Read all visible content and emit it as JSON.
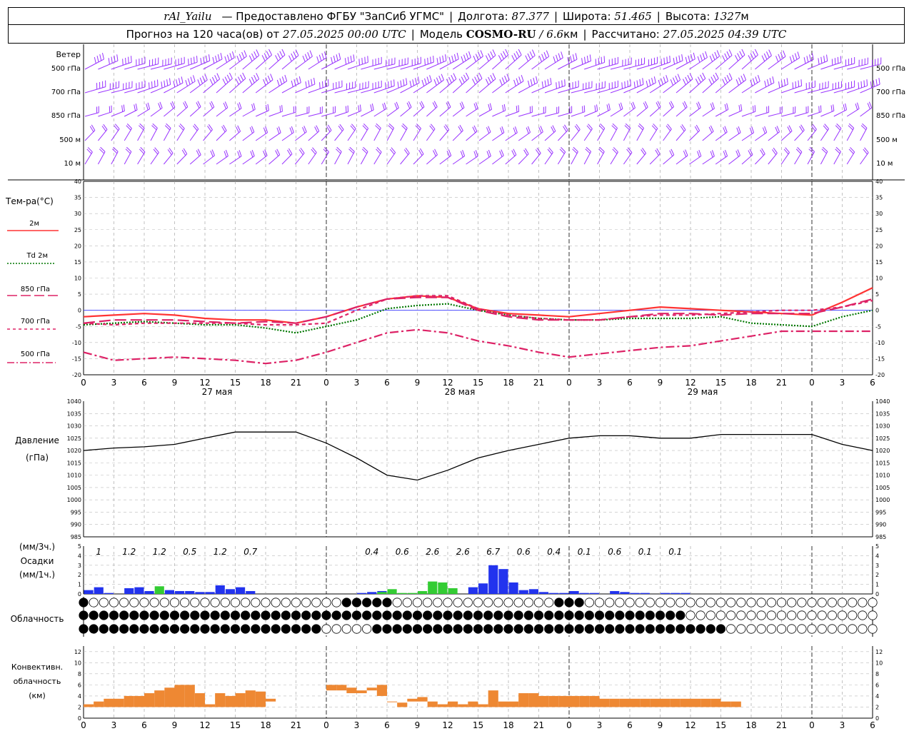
{
  "header": {
    "station": "rAl_Yailu",
    "provider": "— Предоставлено ФГБУ \"ЗапСиб УГМС\"",
    "lon_label": "Долгота:",
    "lon_value": "87.377",
    "lat_label": "Широта:",
    "lat_value": "51.465",
    "alt_label": "Высота:",
    "alt_value": "1327",
    "alt_unit": "м",
    "forecast_label": "Прогноз на 120 часа(ов) от",
    "forecast_start": "27.05.2025 00:00 UTC",
    "model_label": "Модель",
    "model_name": "COSMO-RU",
    "model_res": "/ 6.6",
    "model_res_unit": "км",
    "calc_label": "Рассчитано:",
    "calc_time": "27.05.2025 04:39 UTC"
  },
  "wind": {
    "title": "Ветер",
    "levels": [
      "500 гПа",
      "700 гПа",
      "850 гПа",
      "500 м",
      "10  м"
    ],
    "barb_color": "#9933ff"
  },
  "temperature": {
    "title": "Тем-ра(°C)",
    "legend": [
      {
        "label": "2м",
        "color": "#ff3333"
      },
      {
        "label": "Td  2м",
        "color": "#007700"
      },
      {
        "label": "850 гПа",
        "color": "#dd2266"
      },
      {
        "label": "700 гПа",
        "color": "#dd2266"
      },
      {
        "label": "500 гПа",
        "color": "#dd2266"
      }
    ],
    "y_ticks": [
      40,
      35,
      30,
      25,
      20,
      15,
      10,
      5,
      0,
      -5,
      -10,
      -15,
      -20
    ]
  },
  "time_axis": {
    "hour_labels": [
      "0",
      "3",
      "6",
      "9",
      "12",
      "15",
      "18",
      "21",
      "0",
      "3",
      "6",
      "9",
      "12",
      "15",
      "18",
      "21",
      "0",
      "3",
      "6",
      "9",
      "12",
      "15",
      "18",
      "21",
      "0",
      "3",
      "6"
    ],
    "day_labels": [
      "27 мая",
      "28 мая",
      "29 мая"
    ]
  },
  "pressure": {
    "title": "Давление",
    "unit": "(гПа)",
    "y_ticks": [
      1040,
      1035,
      1030,
      1025,
      1020,
      1015,
      1010,
      1005,
      1000,
      995,
      990,
      985
    ]
  },
  "precip": {
    "title_3h": "(мм/3ч.)",
    "title": "Осадки",
    "title_1h": "(мм/1ч.)",
    "y_ticks": [
      5,
      4,
      3,
      2,
      1,
      0
    ],
    "totals_3h": [
      {
        "hour": 1.5,
        "label": "1"
      },
      {
        "hour": 4.5,
        "label": "1.2"
      },
      {
        "hour": 7.5,
        "label": "1.2"
      },
      {
        "hour": 10.5,
        "label": "0.5"
      },
      {
        "hour": 13.5,
        "label": "1.2"
      },
      {
        "hour": 16.5,
        "label": "0.7"
      },
      {
        "hour": 28.5,
        "label": "0.4"
      },
      {
        "hour": 31.5,
        "label": "0.6"
      },
      {
        "hour": 34.5,
        "label": "2.6"
      },
      {
        "hour": 37.5,
        "label": "2.6"
      },
      {
        "hour": 40.5,
        "label": "6.7"
      },
      {
        "hour": 43.5,
        "label": "0.6"
      },
      {
        "hour": 46.5,
        "label": "0.4"
      },
      {
        "hour": 49.5,
        "label": "0.1"
      },
      {
        "hour": 52.5,
        "label": "0.6"
      },
      {
        "hour": 55.5,
        "label": "0.1"
      },
      {
        "hour": 58.5,
        "label": "0.1"
      }
    ]
  },
  "cloud": {
    "title": "Облачность"
  },
  "convective": {
    "title_1": "Конвективн.",
    "title_2": "облачность",
    "title_3": "(км)",
    "y_ticks": [
      12,
      10,
      8,
      6,
      4,
      2,
      0
    ],
    "color": "#ee8833"
  },
  "chart_data": [
    {
      "type": "line",
      "title": "Тем-ра(°C)",
      "x_unit": "hours since 27.05.2025 00:00 UTC",
      "ylim": [
        -20,
        40
      ],
      "x": [
        0,
        3,
        6,
        9,
        12,
        15,
        18,
        21,
        24,
        27,
        30,
        33,
        36,
        39,
        42,
        45,
        48,
        51,
        54,
        57,
        60,
        63,
        66,
        69,
        72,
        75,
        78
      ],
      "series": [
        {
          "name": "2м",
          "values": [
            -2,
            -1.5,
            -1,
            -1.5,
            -2.5,
            -3,
            -3,
            -4,
            -2,
            1,
            3.5,
            4.5,
            4,
            0.5,
            -1,
            -1.5,
            -2,
            -1,
            0,
            1,
            0.5,
            0,
            -0.5,
            -1,
            -1.5,
            2.5,
            7
          ]
        },
        {
          "name": "Td  2м",
          "values": [
            -4.5,
            -4,
            -3.5,
            -4,
            -4.5,
            -4.5,
            -5.5,
            -7,
            -5,
            -3,
            0.5,
            1.5,
            2,
            0,
            -1.5,
            -2.5,
            -3,
            -3,
            -2.5,
            -2.5,
            -2.5,
            -2,
            -4,
            -4.5,
            -5,
            -2,
            0
          ]
        },
        {
          "name": "850 гПа",
          "values": [
            -4,
            -3,
            -3,
            -3,
            -3.5,
            -4,
            -3.5,
            -4,
            -2,
            1,
            3.5,
            4,
            4,
            0,
            -2,
            -3,
            -3,
            -3,
            -2,
            -1,
            -1,
            -1.5,
            -1,
            -1,
            -1,
            1,
            3.5
          ]
        },
        {
          "name": "700 гПа",
          "values": [
            -4,
            -4.5,
            -4,
            -4,
            -4,
            -4,
            -4.5,
            -4.5,
            -4,
            0,
            3.5,
            4.5,
            4.5,
            0.5,
            -1.5,
            -2.5,
            -3,
            -3,
            -2,
            -1.5,
            -1.5,
            -1,
            -0.5,
            0,
            0,
            1,
            3
          ]
        },
        {
          "name": "500 гПа",
          "values": [
            -13,
            -15.5,
            -15,
            -14.5,
            -15,
            -15.5,
            -16.5,
            -15.5,
            -13,
            -10,
            -7,
            -6,
            -7,
            -9.5,
            -11,
            -13,
            -14.5,
            -13.5,
            -12.5,
            -11.5,
            -11,
            -9.5,
            -8,
            -6.5,
            -6.5,
            -6.5,
            -6.5
          ]
        }
      ]
    },
    {
      "type": "line",
      "title": "Давление",
      "x_unit": "hours since 27.05.2025 00:00 UTC",
      "ylim": [
        985,
        1040
      ],
      "x": [
        0,
        3,
        6,
        9,
        12,
        15,
        18,
        21,
        24,
        27,
        30,
        33,
        36,
        39,
        42,
        45,
        48,
        51,
        54,
        57,
        60,
        63,
        66,
        69,
        72,
        75,
        78
      ],
      "series": [
        {
          "name": "Давление",
          "values": [
            1020,
            1021,
            1021.5,
            1022.5,
            1025,
            1027.5,
            1027.5,
            1027.5,
            1023,
            1017,
            1010,
            1008,
            1012,
            1017,
            1020,
            1022.5,
            1025,
            1026,
            1026,
            1025,
            1025,
            1026.5,
            1026.5,
            1026.5,
            1026.5,
            1022.5,
            1020
          ]
        }
      ]
    },
    {
      "type": "bar",
      "title": "Осадки",
      "x_unit": "hours since 27.05.2025 00:00 UTC",
      "ylim": [
        0,
        5
      ],
      "x": [
        0,
        1,
        2,
        3,
        4,
        5,
        6,
        7,
        8,
        9,
        10,
        11,
        12,
        13,
        14,
        15,
        16,
        17,
        18,
        19,
        20,
        21,
        22,
        23,
        24,
        25,
        26,
        27,
        28,
        29,
        30,
        31,
        32,
        33,
        34,
        35,
        36,
        37,
        38,
        39,
        40,
        41,
        42,
        43,
        44,
        45,
        46,
        47,
        48,
        49,
        50,
        51,
        52,
        53,
        54,
        55,
        56,
        57,
        58,
        59
      ],
      "series": [
        {
          "name": "rain",
          "color": "#2233ee",
          "values": [
            0.4,
            0.7,
            0.1,
            0,
            0.6,
            0.7,
            0.3,
            0,
            0.4,
            0.3,
            0.3,
            0.2,
            0.2,
            0.9,
            0.5,
            0.7,
            0.3,
            0,
            0,
            0,
            0,
            0,
            0,
            0,
            0,
            0,
            0,
            0.1,
            0.2,
            0.3,
            0,
            0,
            0,
            0,
            0,
            0,
            0,
            0,
            0.7,
            1.1,
            3,
            2.6,
            1.2,
            0.4,
            0.5,
            0.2,
            0.1,
            0.1,
            0.3,
            0.1,
            0.1,
            0,
            0.3,
            0.2,
            0.1,
            0.1,
            0,
            0.1,
            0.1,
            0.1
          ]
        },
        {
          "name": "shower",
          "color": "#33cc33",
          "values": [
            0,
            0,
            0,
            0,
            0,
            0,
            0,
            0.8,
            0,
            0,
            0,
            0,
            0,
            0,
            0,
            0,
            0,
            0,
            0,
            0,
            0,
            0,
            0,
            0,
            0,
            0,
            0,
            0,
            0,
            0.2,
            0.5,
            0.1,
            0.1,
            0.3,
            1.3,
            1.2,
            0.6,
            0,
            0,
            0,
            0,
            0,
            0,
            0,
            0,
            0,
            0,
            0,
            0,
            0,
            0,
            0,
            0,
            0,
            0,
            0,
            0,
            0,
            0,
            0
          ]
        }
      ]
    },
    {
      "type": "bar",
      "title": "Конвективн. облачность (км)",
      "x_unit": "hours since 27.05.2025 00:00 UTC",
      "ylim": [
        0,
        13
      ],
      "x": [
        0,
        1,
        2,
        3,
        4,
        5,
        6,
        7,
        8,
        9,
        10,
        11,
        12,
        13,
        14,
        15,
        16,
        17,
        18,
        19,
        20,
        21,
        22,
        23,
        24,
        25,
        26,
        27,
        28,
        29,
        30,
        31,
        32,
        33,
        34,
        35,
        36,
        37,
        38,
        39,
        40,
        41,
        42,
        43,
        44,
        45,
        46,
        47,
        48,
        49,
        50,
        51,
        52,
        53,
        54,
        55,
        56,
        57,
        58,
        59,
        60,
        61,
        62,
        63,
        64
      ],
      "series": [
        {
          "name": "bottom (км)",
          "values": [
            2,
            2,
            2,
            2,
            2,
            2,
            2,
            2,
            2,
            2,
            2,
            2,
            2,
            2,
            2,
            2,
            2,
            2,
            3,
            null,
            null,
            null,
            null,
            null,
            5,
            5,
            4.5,
            4.5,
            5,
            4,
            3,
            2,
            3,
            3,
            2,
            2,
            2,
            2,
            2,
            2,
            2,
            2,
            2,
            2,
            2,
            2,
            2,
            2,
            2,
            2,
            2,
            2,
            2,
            2,
            2,
            2,
            2,
            2,
            2,
            2,
            2,
            2,
            2,
            2,
            2
          ]
        },
        {
          "name": "top (км)",
          "values": [
            2.5,
            3,
            3.5,
            3.5,
            4,
            4,
            4.5,
            5,
            5.5,
            6,
            6,
            4.5,
            2.5,
            4.5,
            4,
            4.5,
            5,
            4.8,
            3.5,
            null,
            null,
            null,
            null,
            null,
            6,
            6,
            5.5,
            5,
            5.5,
            6,
            3,
            2.8,
            3.5,
            3.8,
            3,
            2.5,
            3,
            2.5,
            3,
            2.5,
            5,
            3,
            3,
            4.5,
            4.5,
            4,
            4,
            4,
            4,
            4,
            4,
            3.5,
            3.5,
            3.5,
            3.5,
            3.5,
            3.5,
            3.5,
            3.5,
            3.5,
            3.5,
            3.5,
            3.5,
            3,
            3
          ]
        }
      ]
    }
  ]
}
